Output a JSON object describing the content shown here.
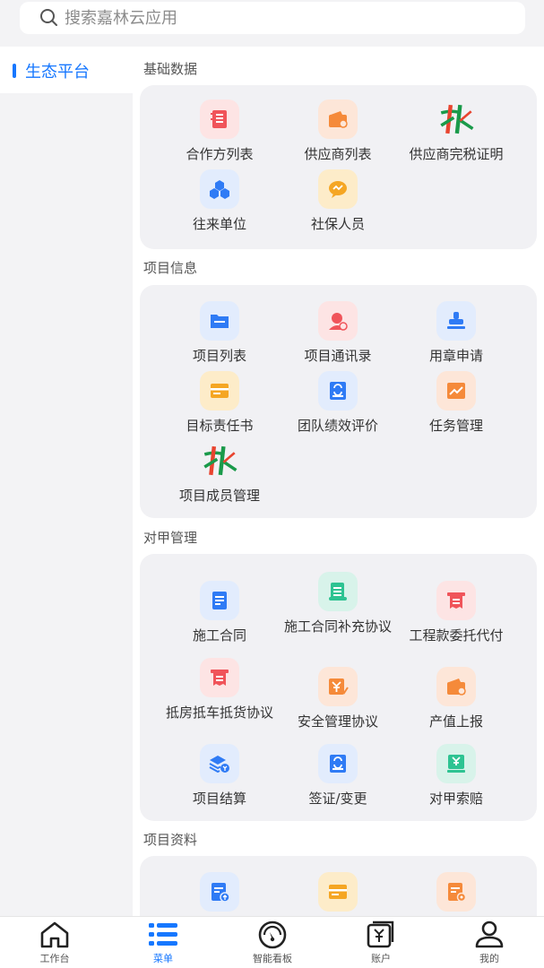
{
  "search": {
    "placeholder": "搜索嘉林云应用"
  },
  "sidebar": {
    "items": [
      {
        "label": "生态平台"
      }
    ]
  },
  "sections": [
    {
      "title": "基础数据",
      "items": [
        {
          "label": "合作方列表",
          "icon": "contact-book-icon"
        },
        {
          "label": "供应商列表",
          "icon": "wallet-icon"
        },
        {
          "label": "供应商完税证明",
          "icon": "brand-logo-icon"
        },
        {
          "label": "往来单位",
          "icon": "cubes-icon"
        },
        {
          "label": "社保人员",
          "icon": "chat-bubble-icon"
        }
      ]
    },
    {
      "title": "项目信息",
      "items": [
        {
          "label": "项目列表",
          "icon": "folder-icon"
        },
        {
          "label": "项目通讯录",
          "icon": "person-badge-icon"
        },
        {
          "label": "用章申请",
          "icon": "stamp-icon"
        },
        {
          "label": "目标责任书",
          "icon": "card-icon"
        },
        {
          "label": "团队绩效评价",
          "icon": "refresh-doc-icon"
        },
        {
          "label": "任务管理",
          "icon": "chart-icon"
        },
        {
          "label": "项目成员管理",
          "icon": "brand-logo-icon"
        }
      ]
    },
    {
      "title": "对甲管理",
      "items": [
        {
          "label": "施工合同",
          "icon": "document-icon"
        },
        {
          "label": "施工合同补充协议",
          "icon": "scroll-icon"
        },
        {
          "label": "工程款委托代付",
          "icon": "receipt-icon"
        },
        {
          "label": "抵房抵车抵货协议",
          "icon": "receipt-icon"
        },
        {
          "label": "安全管理协议",
          "icon": "yen-check-icon"
        },
        {
          "label": "产值上报",
          "icon": "wallet-icon"
        },
        {
          "label": "项目结算",
          "icon": "layers-icon"
        },
        {
          "label": "签证/变更",
          "icon": "refresh-doc-icon"
        },
        {
          "label": "对甲索赔",
          "icon": "yen-doc-icon"
        }
      ]
    },
    {
      "title": "项目资料",
      "items": [
        {
          "label": "",
          "icon": "doc-upload-icon"
        },
        {
          "label": "",
          "icon": "card-icon"
        },
        {
          "label": "",
          "icon": "doc-gear-icon"
        }
      ]
    }
  ],
  "tabbar": [
    {
      "label": "工作台",
      "icon": "home-icon"
    },
    {
      "label": "菜单",
      "icon": "menu-list-icon"
    },
    {
      "label": "智能看板",
      "icon": "gauge-icon"
    },
    {
      "label": "账户",
      "icon": "yen-account-icon"
    },
    {
      "label": "我的",
      "icon": "user-icon"
    }
  ],
  "colors": {
    "accent": "#1677ff",
    "red": "#f0545a",
    "orange": "#f58a3a",
    "blue": "#2f7bf5",
    "yellow": "#f5a623",
    "teal": "#2ec392",
    "logo_green": "#1a9a4a",
    "logo_red": "#e8442f"
  }
}
